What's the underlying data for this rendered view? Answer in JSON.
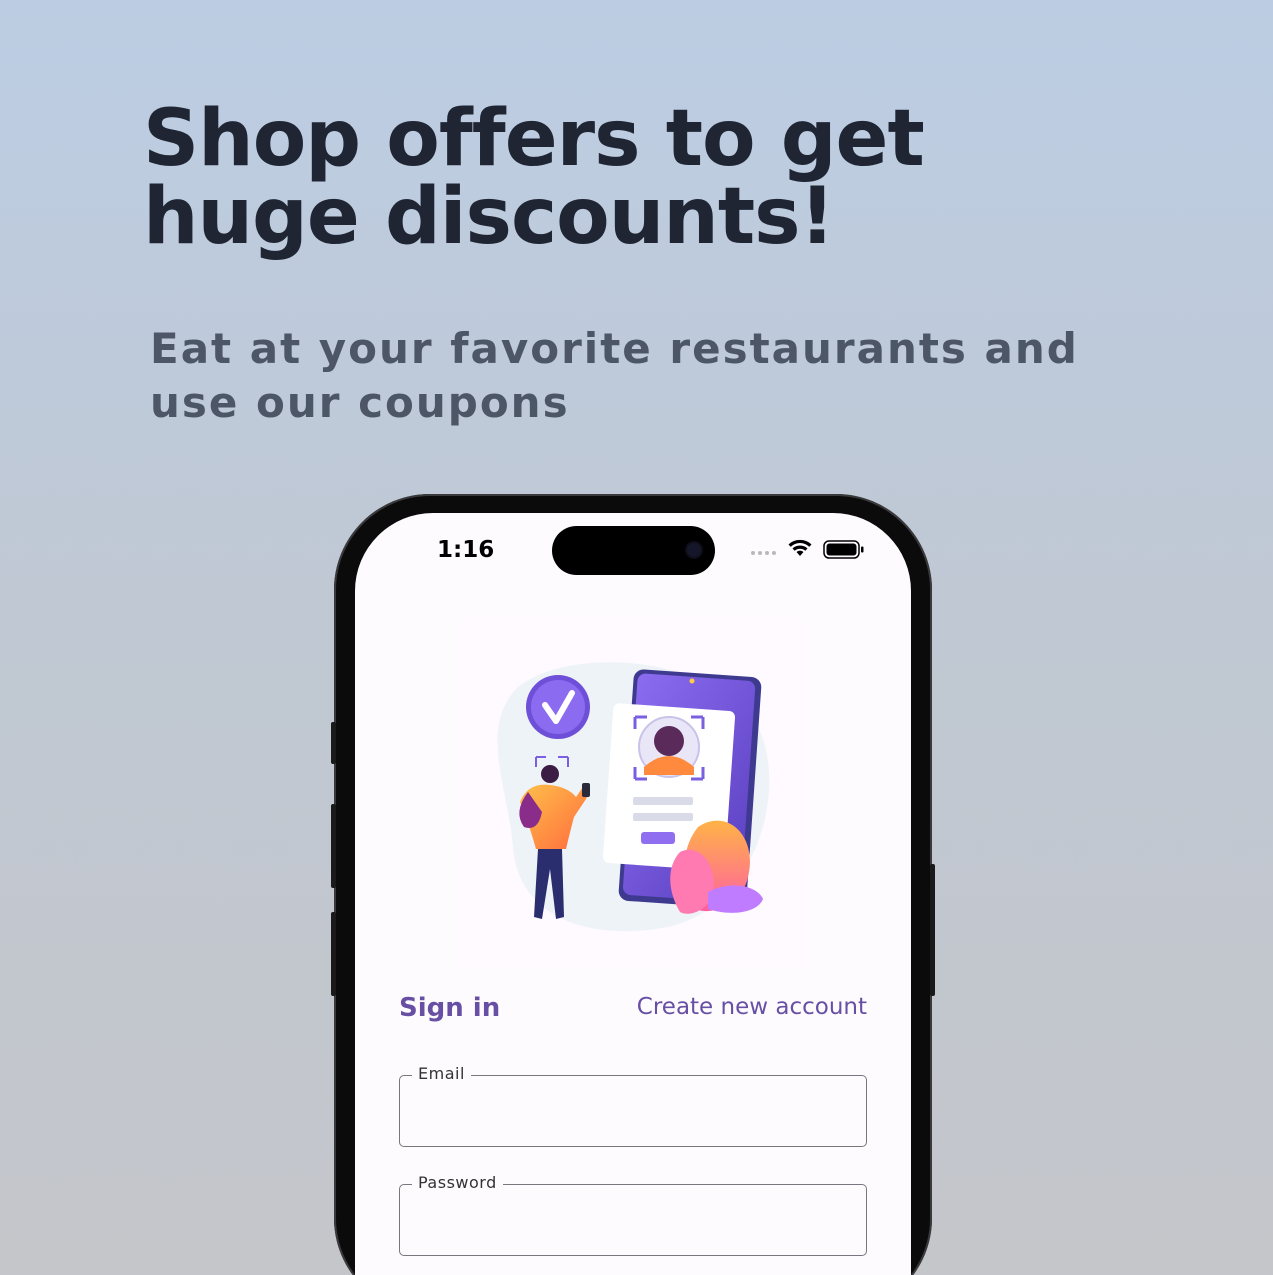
{
  "promo": {
    "headline": "Shop offers to get huge discounts!",
    "subheadline": "Eat at your favorite restaurants and use our coupons"
  },
  "status_bar": {
    "time": "1:16"
  },
  "auth": {
    "tab_sign_in": "Sign in",
    "tab_create_account": "Create new account",
    "email_label": "Email",
    "email_value": "",
    "password_label": "Password",
    "password_value": ""
  },
  "icons": [
    "wifi-icon",
    "battery-icon",
    "cellular-signal-icon",
    "checkmark-badge-icon"
  ],
  "colors": {
    "accent": "#6750a4",
    "headline": "#1f2533",
    "subheadline": "#4d5666"
  }
}
